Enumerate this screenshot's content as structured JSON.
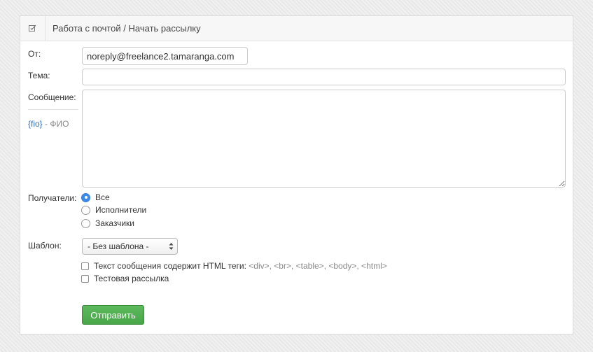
{
  "header": {
    "title": "Работа с почтой / Начать рассылку",
    "icon": "edit-icon"
  },
  "form": {
    "from_label": "От:",
    "from_value": "noreply@freelance2.tamaranga.com",
    "subject_label": "Тема:",
    "subject_value": "",
    "message_label": "Сообщение:",
    "message_value": "",
    "hint_token": "{fio}",
    "hint_text": " - ФИО",
    "recipients_label": "Получатели:",
    "recipients": [
      {
        "label": "Все",
        "checked": true
      },
      {
        "label": "Исполнители",
        "checked": false
      },
      {
        "label": "Заказчики",
        "checked": false
      }
    ],
    "template_label": "Шаблон:",
    "template_selected": "- Без шаблона -",
    "html_check_label": "Текст сообщения содержит HTML теги:",
    "html_check_tags": " <div>, <br>, <table>, <body>, <html>",
    "test_check_label": "Тестовая рассылка",
    "submit_label": "Отправить"
  },
  "colors": {
    "accent": "#3b8bea",
    "submit": "#5cb85c",
    "link": "#2a6ebb"
  }
}
